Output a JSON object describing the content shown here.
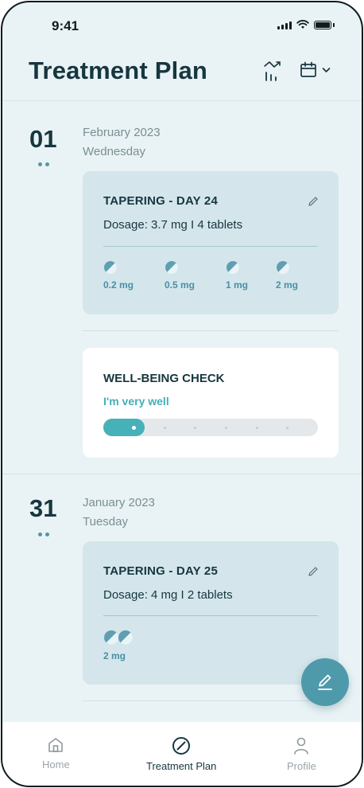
{
  "status_bar": {
    "time": "9:41"
  },
  "header": {
    "title": "Treatment Plan"
  },
  "days": [
    {
      "day_number": "01",
      "month_year": "February 2023",
      "weekday": "Wednesday",
      "tapering": {
        "title": "TAPERING - DAY 24",
        "dosage": "Dosage: 3.7 mg  I  4 tablets",
        "pills": [
          "0.2 mg",
          "0.5 mg",
          "1 mg",
          "2 mg"
        ]
      },
      "wellbeing": {
        "title": "WELL-BEING CHECK",
        "value": "I'm very well",
        "level_fraction": 0.2
      }
    },
    {
      "day_number": "31",
      "month_year": "January 2023",
      "weekday": "Tuesday",
      "tapering": {
        "title": "TAPERING - DAY 25",
        "dosage": "Dosage: 4 mg  I  2 tablets",
        "pills": [
          "2 mg"
        ]
      }
    }
  ],
  "nav": {
    "items": [
      {
        "label": "Home",
        "icon": "home-icon"
      },
      {
        "label": "Treatment Plan",
        "icon": "no-entry-icon"
      },
      {
        "label": "Profile",
        "icon": "person-icon"
      }
    ],
    "active": "Treatment Plan"
  },
  "colors": {
    "background": "#e9f3f5",
    "card": "#d4e6ec",
    "accent": "#46b1b8",
    "fab": "#4e9aab",
    "text": "#17363f"
  }
}
